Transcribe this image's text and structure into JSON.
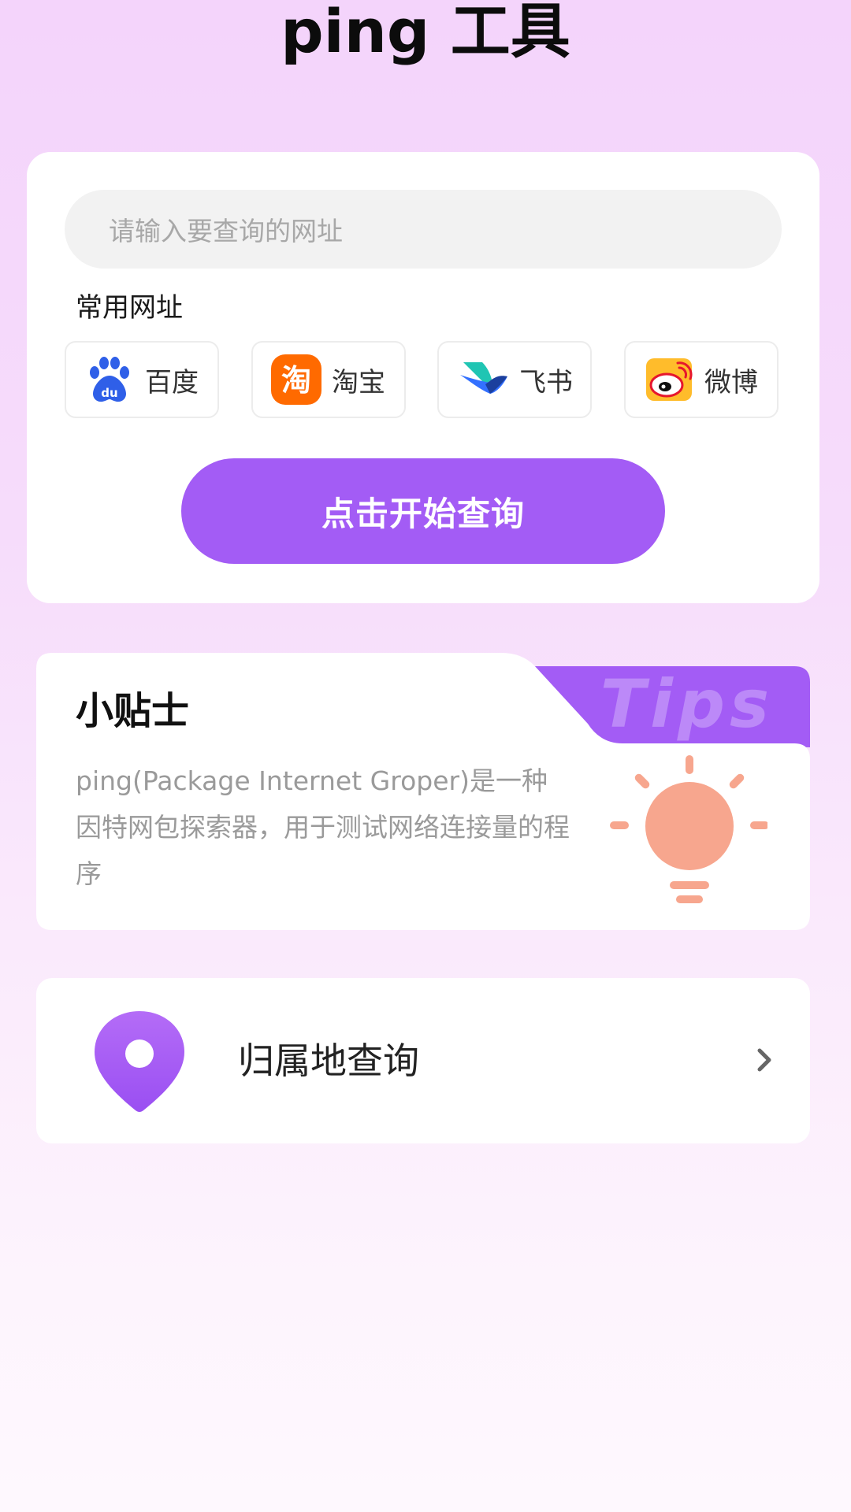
{
  "header": {
    "title": "ping 工具"
  },
  "search": {
    "placeholder": "请输入要查询的网址",
    "common_sites_label": "常用网址",
    "sites": [
      {
        "label": "百度",
        "icon": "baidu-icon"
      },
      {
        "label": "淘宝",
        "icon": "taobao-icon"
      },
      {
        "label": "飞书",
        "icon": "feishu-icon"
      },
      {
        "label": "微博",
        "icon": "weibo-icon"
      }
    ],
    "start_label": "点击开始查询"
  },
  "tips": {
    "heading": "小贴士",
    "badge": "Tips",
    "text": "ping(Package Internet Groper)是一种因特网包探索器，用于测试网络连接量的程序"
  },
  "location": {
    "label": "归属地查询"
  },
  "colors": {
    "accent": "#a35cf5",
    "bulb": "#f7a68e",
    "baidu": "#2f5fe8",
    "taobao": "#ff6a00",
    "weibo": "#e6162d"
  }
}
